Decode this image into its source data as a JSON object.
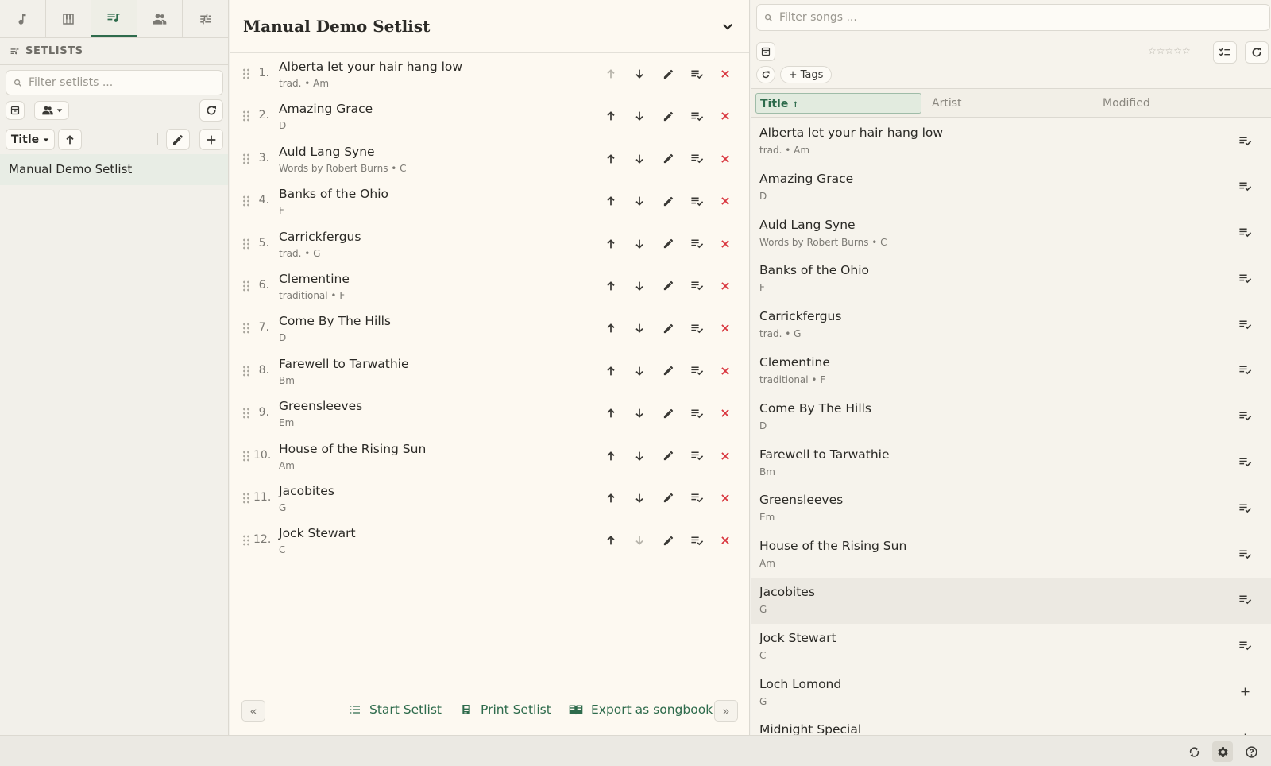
{
  "nav_tabs": [
    {
      "name": "songs",
      "icon": "music-note-icon"
    },
    {
      "name": "piano",
      "icon": "piano-icon"
    },
    {
      "name": "setlists",
      "icon": "playlist-music-icon",
      "active": true
    },
    {
      "name": "groups",
      "icon": "people-icon"
    },
    {
      "name": "settings",
      "icon": "sliders-icon"
    }
  ],
  "sidebar": {
    "section_title": "SETLISTS",
    "filter_placeholder": "Filter setlists ...",
    "sort_label": "Title",
    "setlists": [
      "Manual Demo Setlist"
    ]
  },
  "setlist": {
    "title": "Manual Demo Setlist",
    "songs": [
      {
        "num": "1.",
        "title": "Alberta let your hair hang low",
        "subtitle": "trad. • Am"
      },
      {
        "num": "2.",
        "title": "Amazing Grace",
        "subtitle": "D"
      },
      {
        "num": "3.",
        "title": "Auld Lang Syne",
        "subtitle": "Words by Robert Burns • C"
      },
      {
        "num": "4.",
        "title": "Banks of the Ohio",
        "subtitle": "F"
      },
      {
        "num": "5.",
        "title": "Carrickfergus",
        "subtitle": "trad. • G"
      },
      {
        "num": "6.",
        "title": "Clementine",
        "subtitle": "traditional • F"
      },
      {
        "num": "7.",
        "title": "Come By The Hills",
        "subtitle": "D"
      },
      {
        "num": "8.",
        "title": "Farewell to Tarwathie",
        "subtitle": "Bm"
      },
      {
        "num": "9.",
        "title": "Greensleeves",
        "subtitle": "Em"
      },
      {
        "num": "10.",
        "title": "House of the Rising Sun",
        "subtitle": "Am"
      },
      {
        "num": "11.",
        "title": "Jacobites",
        "subtitle": "G"
      },
      {
        "num": "12.",
        "title": "Jock Stewart",
        "subtitle": "C"
      }
    ],
    "footer": {
      "start_label": "Start Setlist",
      "print_label": "Print Setlist",
      "export_label": "Export as songbook",
      "collapse_left": "«",
      "collapse_right": "»"
    }
  },
  "songs_panel": {
    "filter_placeholder": "Filter songs ...",
    "rating_stars": "☆☆☆☆☆",
    "tags_label": "+ Tags",
    "columns": {
      "title": "Title",
      "title_sort_indicator": "↑",
      "artist": "Artist",
      "modified": "Modified"
    },
    "songs": [
      {
        "title": "Alberta let your hair hang low",
        "subtitle": "trad. • Am",
        "in_setlist": true
      },
      {
        "title": "Amazing Grace",
        "subtitle": "D",
        "in_setlist": true
      },
      {
        "title": "Auld Lang Syne",
        "subtitle": "Words by Robert Burns • C",
        "in_setlist": true
      },
      {
        "title": "Banks of the Ohio",
        "subtitle": "F",
        "in_setlist": true
      },
      {
        "title": "Carrickfergus",
        "subtitle": "trad. • G",
        "in_setlist": true
      },
      {
        "title": "Clementine",
        "subtitle": "traditional • F",
        "in_setlist": true
      },
      {
        "title": "Come By The Hills",
        "subtitle": "D",
        "in_setlist": true
      },
      {
        "title": "Farewell to Tarwathie",
        "subtitle": "Bm",
        "in_setlist": true
      },
      {
        "title": "Greensleeves",
        "subtitle": "Em",
        "in_setlist": true
      },
      {
        "title": "House of the Rising Sun",
        "subtitle": "Am",
        "in_setlist": true
      },
      {
        "title": "Jacobites",
        "subtitle": "G",
        "in_setlist": true,
        "highlighted": true
      },
      {
        "title": "Jock Stewart",
        "subtitle": "C",
        "in_setlist": true
      },
      {
        "title": "Loch Lomond",
        "subtitle": "G",
        "in_setlist": false
      },
      {
        "title": "Midnight Special",
        "subtitle": "",
        "in_setlist": false
      }
    ]
  },
  "status_bar": {
    "icons": [
      "sync-icon",
      "gear-icon",
      "help-icon"
    ]
  },
  "colors": {
    "accent": "#2e6b4c",
    "remove": "#d9363e",
    "panel_bg": "#fdf9f1",
    "sidebar_bg": "#f2f0ea",
    "selected_row": "#e8ede5"
  }
}
